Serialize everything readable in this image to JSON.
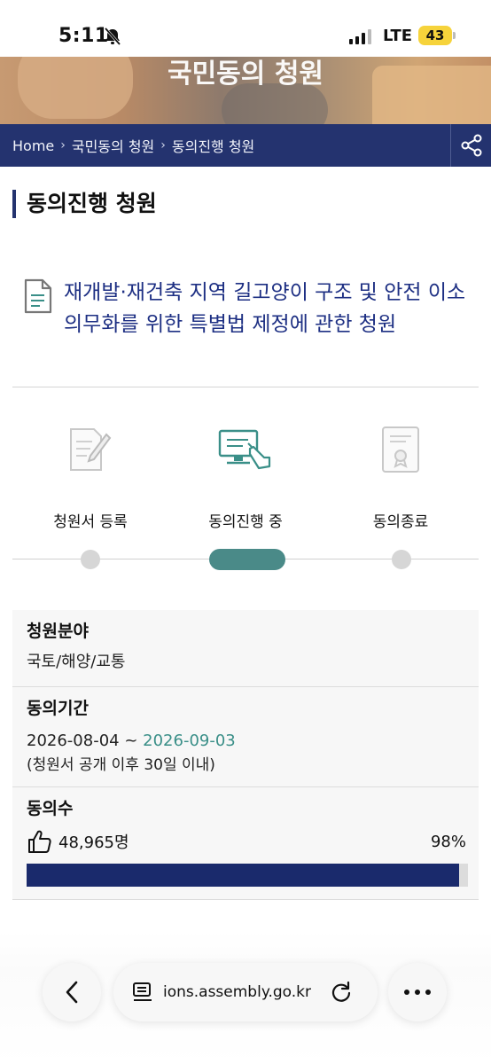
{
  "status_bar": {
    "time": "5:11",
    "network": "LTE",
    "battery": "43"
  },
  "hero": {
    "title": "국민동의 청원"
  },
  "breadcrumb": [
    "Home",
    "국민동의 청원",
    "동의진행 청원"
  ],
  "page_heading": "동의진행 청원",
  "petition": {
    "title": "재개발·재건축 지역 길고양이 구조 및 안전 이소 의무화를 위한 특별법 제정에 관한 청원"
  },
  "steps": [
    {
      "label": "청원서 등록",
      "icon": "document-pen-icon",
      "active": false
    },
    {
      "label": "동의진행 중",
      "icon": "monitor-hand-icon",
      "active": true
    },
    {
      "label": "동의종료",
      "icon": "certificate-icon",
      "active": false
    }
  ],
  "info": {
    "field_label": "청원분야",
    "field_value": "국토/해양/교통",
    "period_label": "동의기간",
    "period_start": "2026-08-04",
    "period_sep": " ~ ",
    "period_end": "2026-09-03",
    "period_note": "(청원서 공개 이후 30일 이내)",
    "count_label": "동의수",
    "count_value": "48,965명",
    "percent_text": "98%",
    "percent_value": 98
  },
  "browser": {
    "url": "ions.assembly.go.kr"
  },
  "colors": {
    "navy": "#24336f",
    "title_blue": "#1d2f83",
    "teal": "#4a8a88",
    "bar_fill": "#1a2a6c"
  }
}
